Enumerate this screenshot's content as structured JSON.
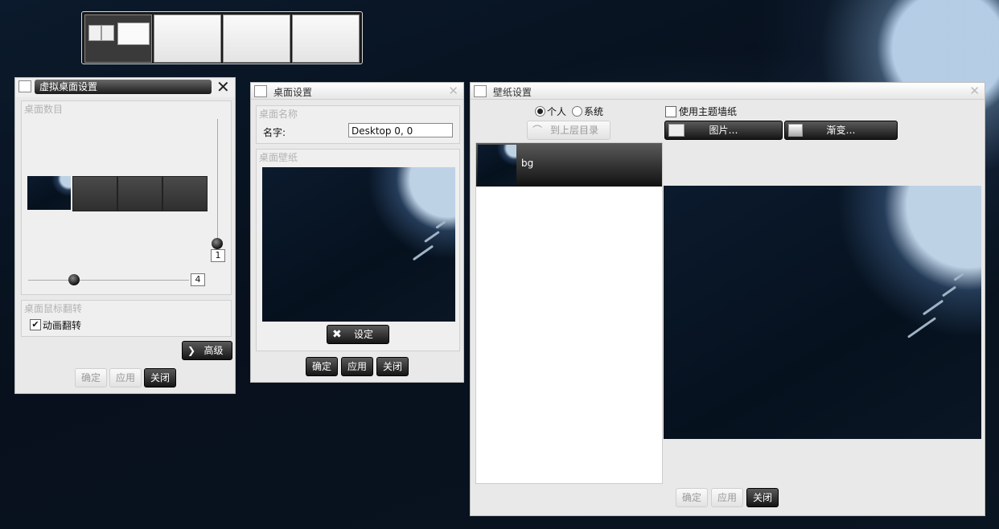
{
  "pager": {
    "desktops": 4
  },
  "virtual_desktop_window": {
    "title": "虚拟桌面设置",
    "desktop_count_label": "桌面数目",
    "vertical_spin_value": "1",
    "horizontal_spin_value": "4",
    "flip_group_label": "桌面鼠标翻转",
    "animate_flip_label": "动画翻转",
    "animate_flip_checked": true,
    "advanced_button": "高级",
    "ok_button": "确定",
    "apply_button": "应用",
    "close_button": "关闭"
  },
  "desktop_settings_window": {
    "title": "桌面设置",
    "name_group_label": "桌面名称",
    "name_label": "名字:",
    "name_value": "Desktop 0, 0",
    "wallpaper_group_label": "桌面壁纸",
    "set_button": "设定",
    "ok_button": "确定",
    "apply_button": "应用",
    "close_button": "关闭"
  },
  "wallpaper_window": {
    "title": "壁纸设置",
    "radio_personal": "个人",
    "radio_system": "系统",
    "selected_source": "个人",
    "up_dir_button": "到上层目录",
    "use_theme_wallpaper_label": "使用主题墙纸",
    "use_theme_wallpaper_checked": false,
    "picture_button": "图片…",
    "gradient_button": "渐变…",
    "files": [
      {
        "name": "bg"
      }
    ],
    "ok_button": "确定",
    "apply_button": "应用",
    "close_button": "关闭"
  },
  "colors": {
    "dark_button": "#151515",
    "window_bg": "#e9e9e9"
  }
}
